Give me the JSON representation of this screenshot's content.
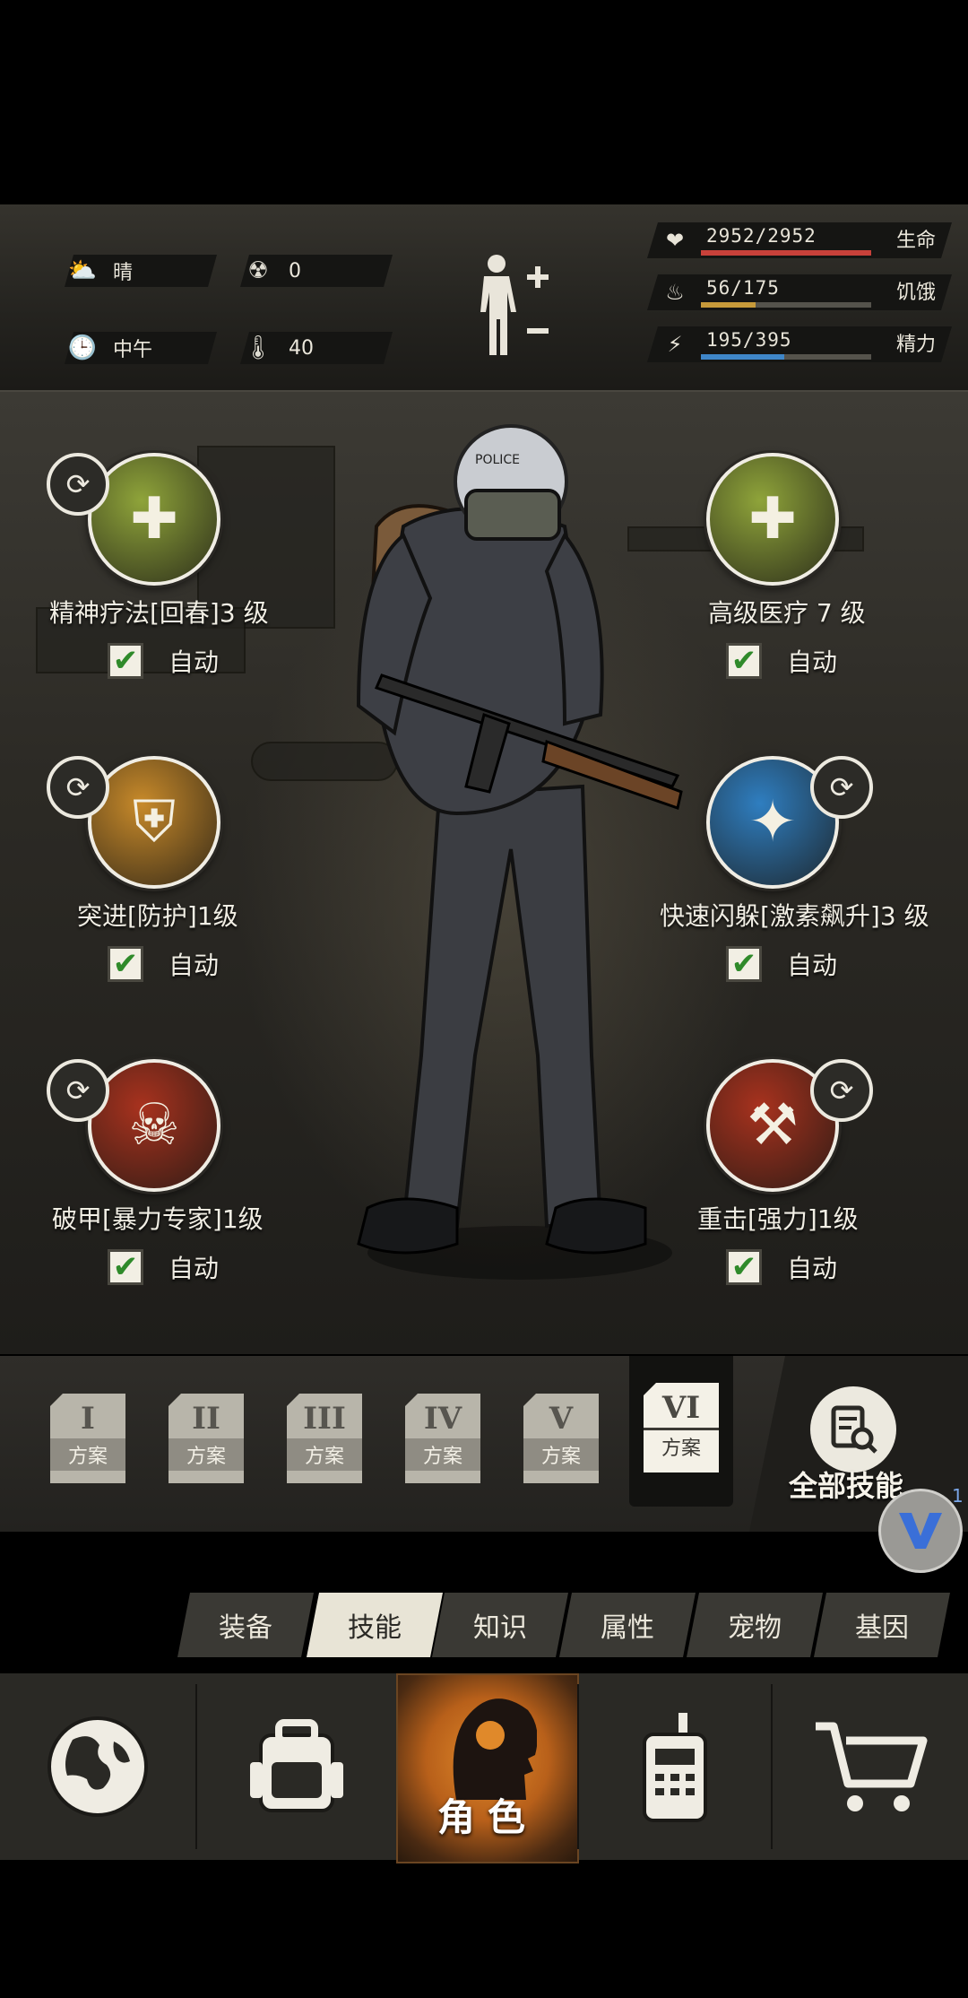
{
  "status": {
    "weather": {
      "icon": "cloud-sun-icon",
      "label": "晴"
    },
    "radiation": {
      "icon": "radiation-icon",
      "value": "0"
    },
    "time": {
      "icon": "clock-icon",
      "label": "中午"
    },
    "temperature": {
      "icon": "thermometer-icon",
      "value": "40"
    },
    "body_icon": "body-toggle-icon",
    "vitals": [
      {
        "icon": "heart-rate-icon",
        "value": "2952/2952",
        "label": "生命",
        "fraction": 1.0,
        "color": "#c8413a"
      },
      {
        "icon": "stomach-icon",
        "value": "56/175",
        "label": "饥饿",
        "fraction": 0.32,
        "color": "#c79a3a"
      },
      {
        "icon": "energy-head-icon",
        "value": "195/395",
        "label": "精力",
        "fraction": 0.49,
        "color": "#3f86c8"
      }
    ]
  },
  "skills": [
    {
      "name": "精神疗法[回春]3 级",
      "auto_label": "自动",
      "checked": true,
      "color": "#8fa43a",
      "icon": "spirit-heal-icon"
    },
    {
      "name": "高级医疗 7 级",
      "auto_label": "自动",
      "checked": true,
      "color": "#8fa43a",
      "icon": "medkit-icon"
    },
    {
      "name": "突进[防护]1级",
      "auto_label": "自动",
      "checked": true,
      "color": "#c88a2a",
      "icon": "shield-charge-icon"
    },
    {
      "name": "快速闪躲[激素飙升]3 级",
      "auto_label": "自动",
      "checked": true,
      "color": "#2f7ec0",
      "icon": "dodge-icon"
    },
    {
      "name": "破甲[暴力专家]1级",
      "auto_label": "自动",
      "checked": true,
      "color": "#a8321e",
      "icon": "skull-dice-icon"
    },
    {
      "name": "重击[强力]1级",
      "auto_label": "自动",
      "checked": true,
      "color": "#a8321e",
      "icon": "axe-strike-icon"
    }
  ],
  "plans": [
    {
      "roman": "I",
      "label": "方案"
    },
    {
      "roman": "II",
      "label": "方案"
    },
    {
      "roman": "III",
      "label": "方案"
    },
    {
      "roman": "IV",
      "label": "方案"
    },
    {
      "roman": "V",
      "label": "方案"
    },
    {
      "roman": "VI",
      "label": "方案",
      "active": true
    }
  ],
  "all_skills_label": "全部技能",
  "vpn_badge": "1",
  "tabs": [
    "装备",
    "技能",
    "知识",
    "属性",
    "宠物",
    "基因"
  ],
  "active_tab": "技能",
  "nav": {
    "items": [
      "globe-icon",
      "backpack-icon",
      "role-head-icon",
      "radio-icon",
      "cart-icon"
    ],
    "role_label": "角色"
  }
}
